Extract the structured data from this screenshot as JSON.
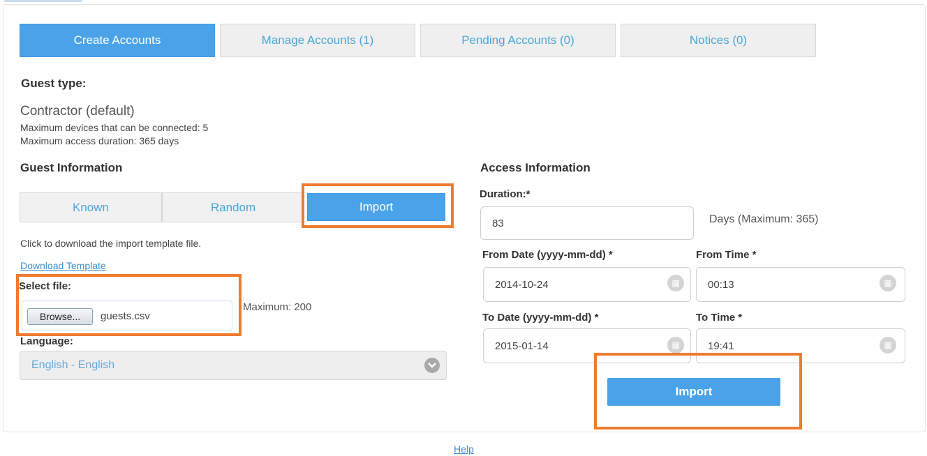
{
  "tabs": [
    {
      "label": "Create Accounts",
      "active": true
    },
    {
      "label": "Manage Accounts (1)",
      "active": false
    },
    {
      "label": "Pending Accounts (0)",
      "active": false
    },
    {
      "label": "Notices (0)",
      "active": false
    }
  ],
  "guest_type": {
    "heading": "Guest type:",
    "name": "Contractor (default)",
    "max_devices": "Maximum devices that can be connected: 5",
    "max_duration": "Maximum access duration: 365 days"
  },
  "guest_info": {
    "heading": "Guest Information",
    "modes": [
      {
        "label": "Known",
        "active": false
      },
      {
        "label": "Random",
        "active": false
      },
      {
        "label": "Import",
        "active": true
      }
    ],
    "download_hint": "Click to download the import template file.",
    "download_link": "Download Template",
    "select_file_label": "Select file:",
    "browse_label": "Browse...",
    "file_name": "guests.csv",
    "max_note": "Maximum: 200",
    "language_label": "Language:",
    "language_value": "English - English"
  },
  "access_info": {
    "heading": "Access Information",
    "duration_label": "Duration:*",
    "duration_value": "83",
    "duration_note": "Days (Maximum: 365)",
    "from_date_label": "From Date (yyyy-mm-dd) *",
    "from_date_value": "2014-10-24",
    "from_time_label": "From Time *",
    "from_time_value": "00:13",
    "to_date_label": "To Date (yyyy-mm-dd) *",
    "to_date_value": "2015-01-14",
    "to_time_label": "To Time *",
    "to_time_value": "19:41",
    "import_button": "Import"
  },
  "footer": {
    "help_link": "Help"
  },
  "colors": {
    "accent": "#4aa3e8",
    "highlight": "#ee7c2f",
    "link": "#3b8fd1"
  }
}
